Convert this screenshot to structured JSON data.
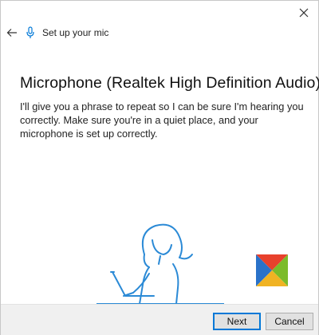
{
  "window": {
    "title": "Set up your mic"
  },
  "icons": {
    "close": "close-icon",
    "back": "back-arrow-icon",
    "mic": "microphone-icon"
  },
  "main": {
    "heading": "Microphone (Realtek High Definition Audio)",
    "body": "I'll give you a phrase to repeat so I can be sure I'm hearing you correctly. Make sure you're in a quiet place, and your microphone is set up correctly."
  },
  "footer": {
    "next_label": "Next",
    "cancel_label": "Cancel"
  },
  "colors": {
    "accent": "#0078d7",
    "logo": [
      "#e8412c",
      "#2a72c9",
      "#7cbb2a",
      "#f0b323"
    ]
  }
}
